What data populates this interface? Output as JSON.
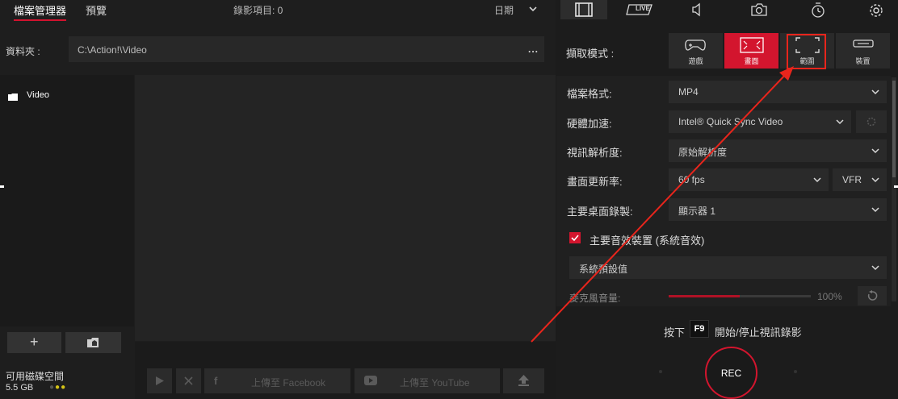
{
  "tabs": {
    "file_manager": "檔案管理器",
    "preview": "預覽"
  },
  "record_count": "錄影項目: 0",
  "sort": {
    "label": "日期"
  },
  "folder": {
    "label": "資料夾 :",
    "path": "C:\\Action!\\Video",
    "more": "..."
  },
  "tree": {
    "items": [
      {
        "label": "Video"
      }
    ]
  },
  "disk": {
    "label": "可用磁碟空間",
    "size": "5.5 GB"
  },
  "actions": {
    "upload_facebook": "上傳至 Facebook",
    "upload_youtube": "上傳至 YouTube"
  },
  "right_tabs": [
    "video-tab",
    "live-tab",
    "audio-tab",
    "camera-tab",
    "timer-tab",
    "settings-tab"
  ],
  "right_tab_live": "LIVE",
  "capture": {
    "label": "擷取模式 :",
    "modes": [
      {
        "label": "遊戲",
        "icon": "gamepad-icon",
        "active": false
      },
      {
        "label": "畫面",
        "icon": "screen-icon",
        "active": true
      },
      {
        "label": "範圍",
        "icon": "region-icon",
        "active": false
      },
      {
        "label": "裝置",
        "icon": "device-icon",
        "active": false
      }
    ]
  },
  "settings": {
    "format": {
      "label": "檔案格式:",
      "value": "MP4"
    },
    "hw_accel": {
      "label": "硬體加速:",
      "value": "Intel® Quick Sync Video"
    },
    "resolution": {
      "label": "視訊解析度:",
      "value": "原始解析度"
    },
    "framerate": {
      "label": "畫面更新率:",
      "value": "60 fps",
      "mode": "VFR"
    },
    "desktop": {
      "label": "主要桌面錄製:",
      "value": "顯示器 1"
    },
    "audio_device": {
      "label": "主要音效裝置 (系統音效)",
      "checked": true
    },
    "audio_default": {
      "value": "系統預設值"
    },
    "mic_volume": {
      "label": "麥克風音量:",
      "value": "100%",
      "level": 0.5
    }
  },
  "hotkey": {
    "prefix": "按下",
    "key": "F9",
    "suffix": "開始/停止視訊錄影"
  },
  "rec_label": "REC",
  "colors": {
    "accent": "#d3152e",
    "annotation": "#e8251c"
  }
}
